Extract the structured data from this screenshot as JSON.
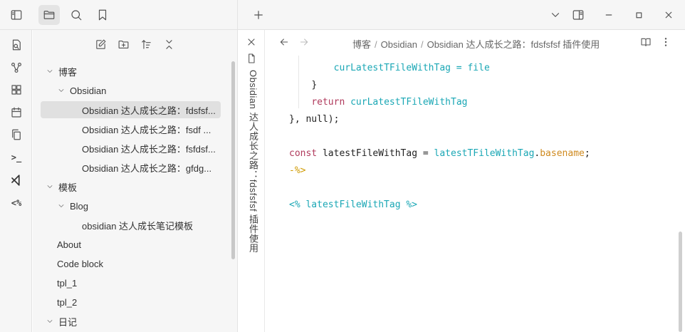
{
  "titlebar": {
    "left_icons": [
      "sidebar-toggle-icon",
      "folder-icon",
      "search-icon",
      "bookmark-icon"
    ],
    "new_tab": "+",
    "window_icons": [
      "chevron-down-icon",
      "split-view-icon",
      "minimize-icon",
      "maximize-icon",
      "close-icon"
    ]
  },
  "ribbon": {
    "icons": [
      "open-quick-switcher-icon",
      "graph-view-icon",
      "canvas-icon",
      "daily-note-icon",
      "copy-icon",
      "terminal-icon",
      "vscode-icon",
      "templater-icon"
    ],
    "templater_label": "<%",
    "terminal_label": ">_"
  },
  "explorer": {
    "toolbar": [
      "new-note-icon",
      "new-folder-icon",
      "sort-icon",
      "collapse-all-icon"
    ],
    "items": [
      {
        "label": "博客",
        "depth": 0,
        "type": "folder",
        "open": true
      },
      {
        "label": "Obsidian",
        "depth": 1,
        "type": "folder",
        "open": true
      },
      {
        "label": "Obsidian 达人成长之路：fdsfsf...",
        "depth": 2,
        "type": "file",
        "selected": true
      },
      {
        "label": "Obsidian 达人成长之路：fsdf ...",
        "depth": 2,
        "type": "file"
      },
      {
        "label": "Obsidian 达人成长之路：fsfdsf...",
        "depth": 2,
        "type": "file"
      },
      {
        "label": "Obsidian 达人成长之路：gfdg...",
        "depth": 2,
        "type": "file"
      },
      {
        "label": "模板",
        "depth": 0,
        "type": "folder",
        "open": true
      },
      {
        "label": "Blog",
        "depth": 1,
        "type": "folder",
        "open": true
      },
      {
        "label": "obsidian 达人成长笔记模板",
        "depth": 2,
        "type": "file"
      },
      {
        "label": "About",
        "depth": 1,
        "type": "file"
      },
      {
        "label": "Code block",
        "depth": 1,
        "type": "file"
      },
      {
        "label": "tpl_1",
        "depth": 1,
        "type": "file"
      },
      {
        "label": "tpl_2",
        "depth": 1,
        "type": "file"
      },
      {
        "label": "日记",
        "depth": 0,
        "type": "folder",
        "open": true
      }
    ]
  },
  "tab": {
    "vertical_title": "Obsidian 达人成长之路：fdsfsfsf 插件使用"
  },
  "editor": {
    "breadcrumb": [
      "博客",
      "Obsidian",
      "Obsidian 达人成长之路：fdsfsfsf 插件使用"
    ],
    "header_icons": [
      "reading-view-icon",
      "more-options-icon"
    ],
    "code_lines": [
      "curLatestTFileWithTag = file",
      "}",
      "return curLatestTFileWithTag",
      "}, null);",
      "",
      "const latestFileWithTag = latestTFileWithTag.basename;",
      "-%>",
      "",
      "<% latestFileWithTag %>"
    ]
  }
}
